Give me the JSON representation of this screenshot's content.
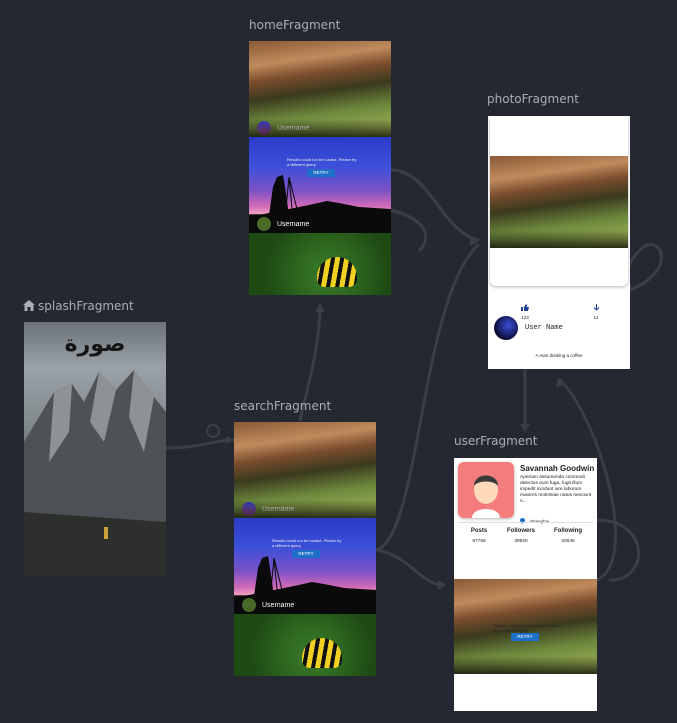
{
  "fragments": {
    "home": {
      "label": "homeFragment",
      "username_1": "Username",
      "username_2": "Username",
      "error_text": "Results could not be loaded. Please try a different query",
      "retry": "RETRY"
    },
    "search": {
      "label": "searchFragment",
      "username_1": "Username",
      "username_2": "Username",
      "error_text": "Results could not be loaded. Please try a different query",
      "retry": "RETRY"
    },
    "photo": {
      "label": "photoFragment",
      "likes": "123",
      "downloads": "12",
      "user_name": "User Name",
      "description": "A man drinking a coffee"
    },
    "splash": {
      "label": "splashFragment",
      "logo_text": "صورة"
    },
    "user": {
      "label": "userFragment",
      "name": "Savannah Goodwin",
      "bio": "Aperiam assumenda commodi delectus eum fuga, fugit illum impedit incidunt iure laborum maiores molestiae natus nesciunt n...",
      "location": "Shanghai",
      "stats": [
        {
          "label": "Posts",
          "value": "97758"
        },
        {
          "label": "Followers",
          "value": "39920"
        },
        {
          "label": "Following",
          "value": "20045"
        }
      ],
      "error_text": "Results could not be loaded. Please try a different query",
      "retry": "RETRY"
    }
  },
  "icons": {
    "home": "home-icon",
    "like": "thumb-up-icon",
    "download": "arrow-down-icon",
    "location": "location-pin-icon",
    "action": "action-arrow-icon"
  },
  "colors": {
    "background": "#252830",
    "edge": "#3a3e47",
    "retry": "#1e6fc8",
    "label": "#a9adb5"
  }
}
